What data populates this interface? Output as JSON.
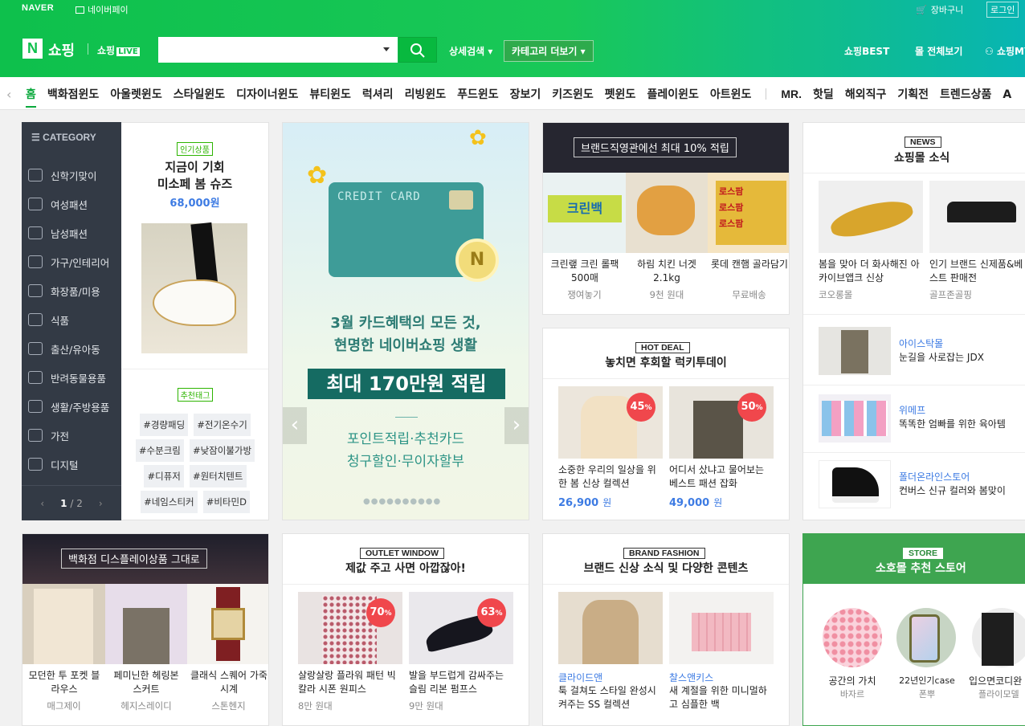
{
  "util": {
    "naver": "NAVER",
    "npay": "네이버페이",
    "cart": "장바구니",
    "login": "로그인"
  },
  "header": {
    "logo": "N",
    "brand": "쇼핑",
    "live": "쇼핑",
    "live_badge": "LIVE",
    "search_placeholder": "",
    "adv": "상세검색",
    "catmore": "카테고리 더보기",
    "links": [
      "쇼핑BEST",
      "몰 전체보기",
      "쇼핑MY"
    ]
  },
  "nav": {
    "items": [
      "홈",
      "백화점윈도",
      "아울렛윈도",
      "스타일윈도",
      "디자이너윈도",
      "뷰티윈도",
      "럭셔리",
      "리빙윈도",
      "푸드윈도",
      "장보기",
      "키즈윈도",
      "펫윈도",
      "플레이윈도",
      "아트윈도"
    ],
    "items2": [
      "MR.",
      "핫딜",
      "해외직구",
      "기획전",
      "트렌드상품",
      "A"
    ]
  },
  "category": {
    "header": "CATEGORY",
    "items": [
      "신학기맞이",
      "여성패션",
      "남성패션",
      "가구/인테리어",
      "화장품/미용",
      "식품",
      "출산/유아동",
      "반려동물용품",
      "생활/주방용품",
      "가전",
      "디지털"
    ],
    "page": "1",
    "pages": "/ 2"
  },
  "popular": {
    "badge": "인기상품",
    "title1": "지금이 기회",
    "title2": "미소페 봄 슈즈",
    "price": "68,000원",
    "tag_badge": "추천태그",
    "tags": [
      "#경량패딩",
      "#전기온수기",
      "#수분크림",
      "#낮잠이불가방",
      "#디퓨저",
      "#원터치텐트",
      "#네임스티커",
      "#비타민D"
    ]
  },
  "banner": {
    "card": "CREDIT CARD",
    "line1": "3월 카드혜택의 모든 것,",
    "line2": "현명한 네이버쇼핑 생활",
    "highlight": "최대 170만원 적립",
    "l3": "포인트적립·추천카드",
    "l4": "청구할인·무이자할부"
  },
  "brandstore": {
    "title": "브랜드직영관에선 최대 10% 적립",
    "items": [
      {
        "name": "크린랲 크린 롤팩 500매",
        "sub": "쟁여놓기"
      },
      {
        "name": "하림 치킨 너겟 2.1kg",
        "sub": "9천 원대"
      },
      {
        "name": "롯데 캔햄 골라담기",
        "sub": "무료배송"
      }
    ]
  },
  "news": {
    "badge": "NEWS",
    "title": "쇼핑몰 소식",
    "items": [
      {
        "name": "봄을 맞아 더 화사해진 아카이브앱크 신상",
        "sub": "코오롱몰"
      },
      {
        "name": "인기 브랜드 신제품&베스트 판매전",
        "sub": "골프존골핑"
      }
    ],
    "list": [
      {
        "shop": "아이스탁몰",
        "desc": "눈길을 사로잡는 JDX"
      },
      {
        "shop": "위메프",
        "desc": "똑똑한 엄빠를 위한 육아템"
      },
      {
        "shop": "폴더온라인스토어",
        "desc": "컨버스 신규 컬러와 봄맞이"
      }
    ]
  },
  "hotdeal": {
    "badge": "HOT DEAL",
    "title": "놓치면 후회할 럭키투데이",
    "items": [
      {
        "pct": "45",
        "desc": "소중한 우리의 일상을 위한 봄 신상 컬렉션",
        "price": "26,900",
        "won": "원"
      },
      {
        "pct": "50",
        "desc": "어디서 샀냐고 물어보는 베스트 패션 잡화",
        "price": "49,000",
        "won": "원"
      }
    ]
  },
  "dept": {
    "title": "백화점 디스플레이상품 그대로",
    "items": [
      {
        "name": "모던한 투 포켓 블라우스",
        "sub": "매그제이"
      },
      {
        "name": "페미닌한 헤링본 스커트",
        "sub": "헤지스레이디"
      },
      {
        "name": "클래식 스퀘어 가죽 시계",
        "sub": "스톤헨지"
      }
    ]
  },
  "outlet": {
    "badge": "OUTLET WINDOW",
    "title": "제값 주고 사면 아깝잖아!",
    "items": [
      {
        "pct": "70",
        "name": "살랑살랑 플라워 패턴 빅 칼라 시폰 원피스",
        "sub": "8만 원대"
      },
      {
        "pct": "63",
        "name": "발을 부드럽게 감싸주는 슬림 리본 펌프스",
        "sub": "9만 원대"
      }
    ]
  },
  "brandfashion": {
    "badge": "BRAND FASHION",
    "title": "브랜드 신상 소식 및 다양한 콘텐츠",
    "items": [
      {
        "shop": "클라이드앤",
        "desc": "툭 걸쳐도 스타일 완성시켜주는 SS 컬렉션"
      },
      {
        "shop": "찰스앤키스",
        "desc": "새 계절을 위한 미니멀하고 심플한 백"
      }
    ]
  },
  "store": {
    "badge": "STORE",
    "title": "소호몰 추천 스토어",
    "items": [
      {
        "name": "공간의 가치",
        "sub": "바자르"
      },
      {
        "name": "22년인기case",
        "sub": "폰뿌"
      },
      {
        "name": "입으면코디완",
        "sub": "플라이모델"
      }
    ]
  },
  "colors": {
    "green": "#0ec04c",
    "blue": "#3d7be3",
    "red": "#f0474c"
  }
}
